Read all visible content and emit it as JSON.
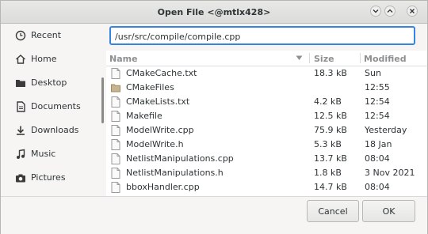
{
  "window": {
    "title": "Open File <@mtlx428>"
  },
  "sidebar": {
    "items": [
      {
        "label": "Recent",
        "icon": "clock-icon"
      },
      {
        "label": "Home",
        "icon": "home-icon"
      },
      {
        "label": "Desktop",
        "icon": "desktop-folder-icon"
      },
      {
        "label": "Documents",
        "icon": "document-icon"
      },
      {
        "label": "Downloads",
        "icon": "download-icon"
      },
      {
        "label": "Music",
        "icon": "music-note-icon"
      },
      {
        "label": "Pictures",
        "icon": "camera-icon"
      }
    ]
  },
  "location": {
    "value": "/usr/src/compile/compile.cpp"
  },
  "columns": {
    "name": "Name",
    "size": "Size",
    "modified": "Modified"
  },
  "files": [
    {
      "name": "CMakeCache.txt",
      "size": "18.3 kB",
      "modified": "Sun",
      "type": "file"
    },
    {
      "name": "CMakeFiles",
      "size": "",
      "modified": "12:55",
      "type": "folder"
    },
    {
      "name": "CMakeLists.txt",
      "size": "4.2 kB",
      "modified": "12:54",
      "type": "file"
    },
    {
      "name": "Makefile",
      "size": "12.5 kB",
      "modified": "12:54",
      "type": "file"
    },
    {
      "name": "ModelWrite.cpp",
      "size": "75.9 kB",
      "modified": "Yesterday",
      "type": "file"
    },
    {
      "name": "ModelWrite.h",
      "size": "5.3 kB",
      "modified": "18 Jan",
      "type": "file"
    },
    {
      "name": "NetlistManipulations.cpp",
      "size": "13.7 kB",
      "modified": "08:04",
      "type": "file"
    },
    {
      "name": "NetlistManipulations.h",
      "size": "1.8 kB",
      "modified": "3 Nov 2021",
      "type": "file"
    },
    {
      "name": "bboxHandler.cpp",
      "size": "14.7 kB",
      "modified": "08:04",
      "type": "file"
    }
  ],
  "buttons": {
    "cancel": "Cancel",
    "ok": "OK"
  }
}
